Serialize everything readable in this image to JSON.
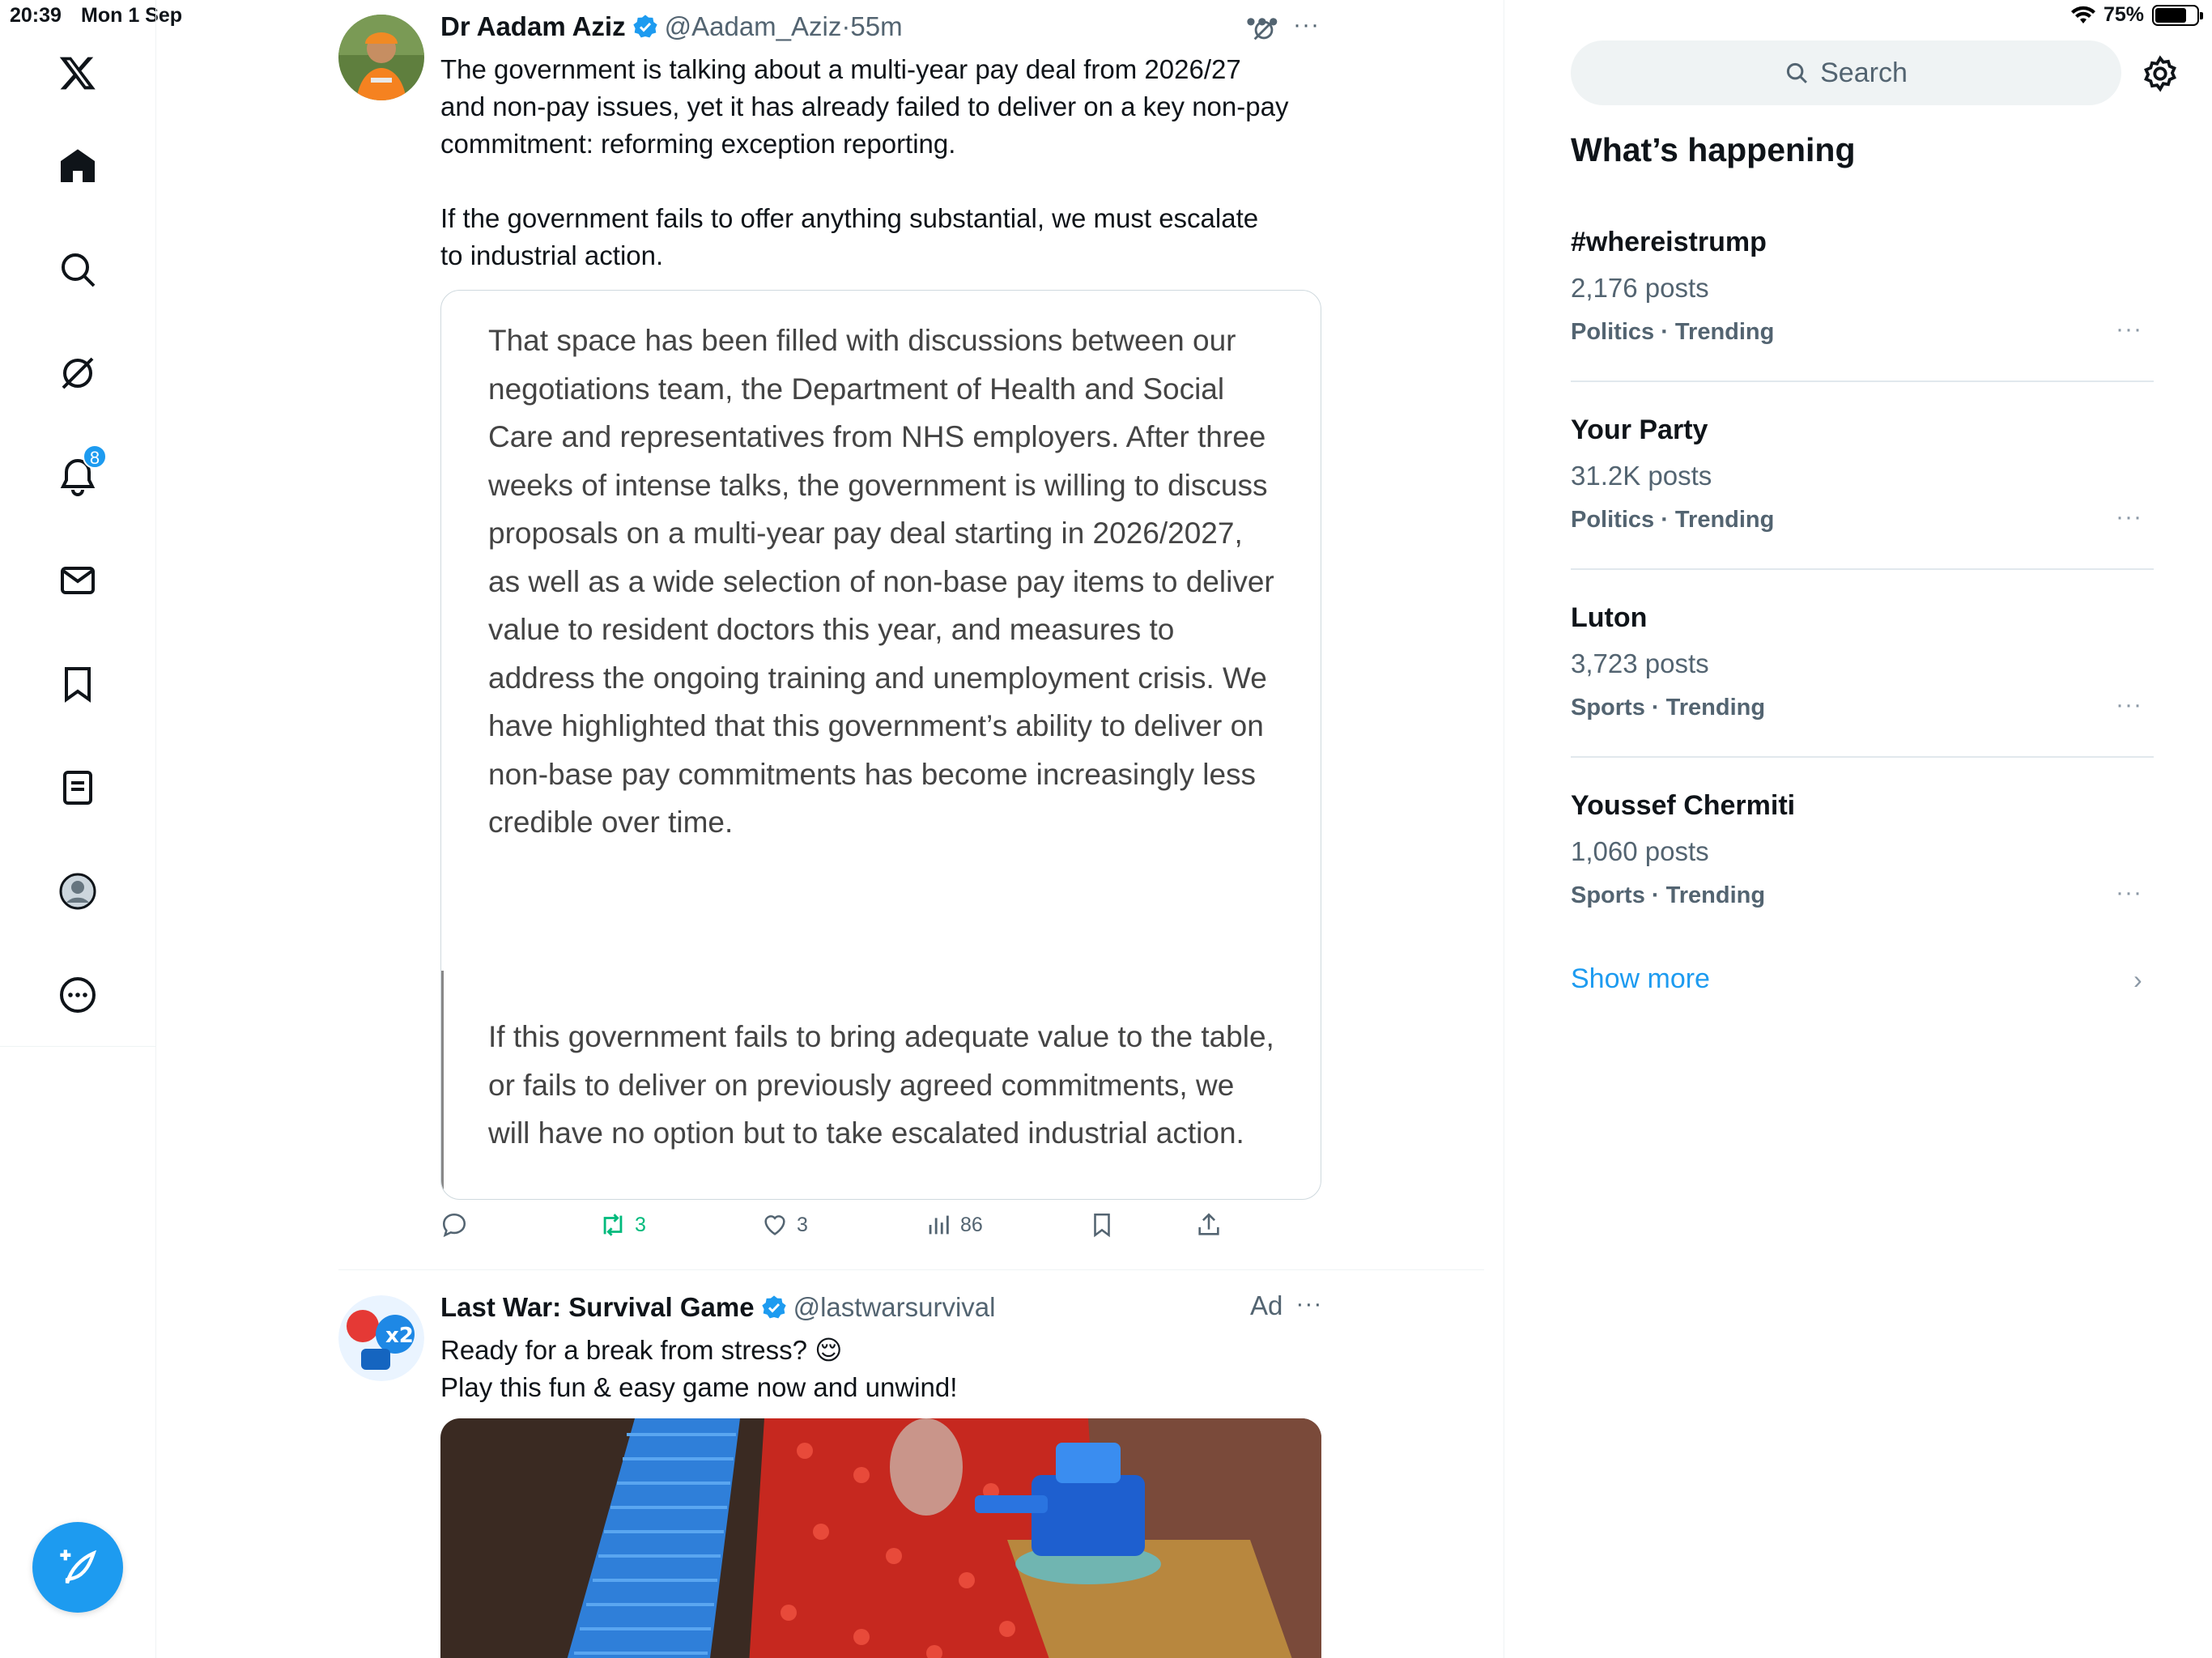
{
  "status_bar": {
    "time": "20:39",
    "date": "Mon 1 Sep",
    "battery": "75%",
    "battery_level": 0.75
  },
  "nav": {
    "items": [
      "x-logo",
      "home",
      "explore",
      "grok",
      "notifications",
      "messages",
      "bookmarks",
      "lists",
      "profile",
      "more"
    ],
    "notifications_badge": "8"
  },
  "tweets": [
    {
      "name": "Dr Aadam Aziz",
      "handle": "@Aadam_Aziz",
      "time": "55m",
      "separator": "·",
      "text": "The government is talking about a multi-year pay deal from 2026/27\nand non-pay issues, yet it has already failed to deliver on a key non-pay\ncommitment: reforming exception reporting.\n\nIf the government fails to offer anything substantial, we must escalate\nto industrial action.",
      "quote_image_text": {
        "paragraph1": "That space has been filled with discussions between our negotiations team, the Department of Health and Social Care and representatives from NHS employers. After three weeks of intense talks, the government is willing to discuss proposals on a multi-year pay deal starting in 2026/2027, as well as a wide selection of non-base pay items to deliver value to resident doctors this year, and measures to address the ongoing training and unemployment crisis. We have highlighted that this government’s ability to deliver on non-base pay commitments has become increasingly less credible over time.",
        "paragraph2": "If this government fails to bring adequate value to the table, or fails to deliver on previously agreed commitments, we will have no option but to take escalated industrial action."
      },
      "actions": {
        "replies": "",
        "retweets": "3",
        "likes": "3",
        "views": "86"
      }
    },
    {
      "name": "Last War: Survival Game",
      "handle": "@lastwarsurvival",
      "ad_label": "Ad",
      "text": "Ready for a break from stress? 😌\nPlay this fun & easy game now and unwind!"
    }
  ],
  "sidebar": {
    "search_placeholder": "Search",
    "title": "What’s happening",
    "trends": [
      {
        "name": "#whereistrump",
        "posts": "2,176 posts",
        "meta": "Politics · Trending"
      },
      {
        "name": "Your Party",
        "posts": "31.2K posts",
        "meta": "Politics · Trending"
      },
      {
        "name": "Luton",
        "posts": "3,723 posts",
        "meta": "Sports · Trending"
      },
      {
        "name": "Youssef Chermiti",
        "posts": "1,060 posts",
        "meta": "Sports · Trending"
      }
    ],
    "show_more": "Show more"
  },
  "colors": {
    "accent": "#1d9bf0",
    "retweet": "#00ba7c",
    "muted": "#536471"
  }
}
